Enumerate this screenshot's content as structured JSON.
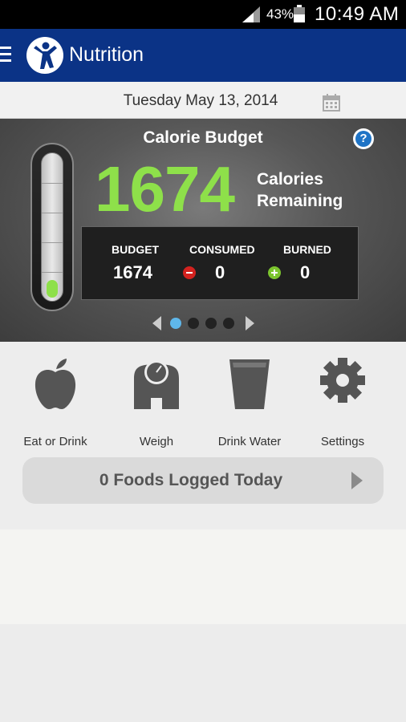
{
  "status_bar": {
    "battery": "43%",
    "time": "10:49 AM",
    "icons": [
      "signal-icon",
      "battery-icon"
    ]
  },
  "app_bar": {
    "title": "Nutrition",
    "icons": [
      "menu-icon",
      "app-logo-icon"
    ],
    "color": "#0b3386"
  },
  "date_row": {
    "date": "Tuesday May 13, 2014",
    "icon": "calendar-icon"
  },
  "budget": {
    "title": "Calorie Budget",
    "help_label": "?",
    "remaining_value": "1674",
    "remaining_label_1": "Calories",
    "remaining_label_2": "Remaining",
    "thermometer_level": 0.05,
    "accent": "#8ee04a",
    "stats": {
      "budget_label": "BUDGET",
      "budget_value": "1674",
      "consumed_label": "CONSUMED",
      "consumed_value": "0",
      "burned_label": "BURNED",
      "burned_value": "0"
    },
    "pager": {
      "pages": 4,
      "active": 0
    }
  },
  "actions": [
    {
      "label": "Eat or Drink",
      "icon": "apple-icon"
    },
    {
      "label": "Weigh",
      "icon": "scale-icon"
    },
    {
      "label": "Drink Water",
      "icon": "water-glass-icon"
    },
    {
      "label": "Settings",
      "icon": "gear-icon"
    }
  ],
  "foods_logged": {
    "label": "0 Foods Logged Today",
    "icon": "chevron-right-icon"
  }
}
